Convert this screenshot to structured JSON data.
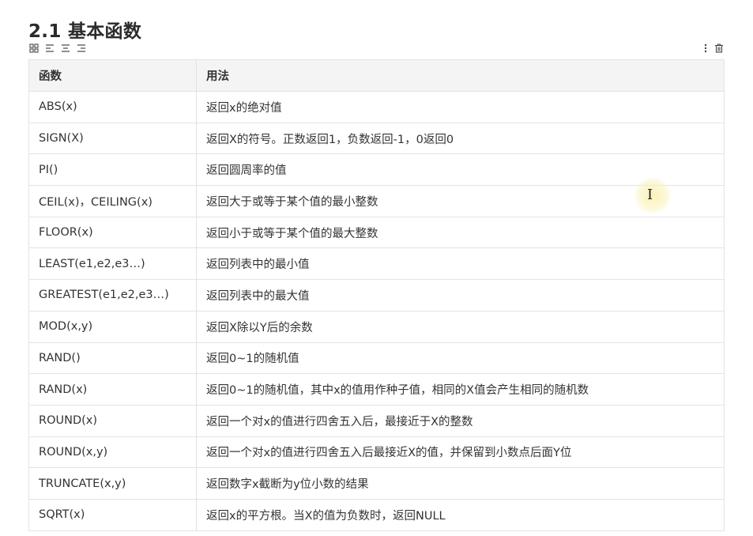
{
  "heading": "2.1 基本函数",
  "table": {
    "headers": [
      "函数",
      "用法"
    ],
    "rows": [
      [
        "ABS(x)",
        "返回x的绝对值"
      ],
      [
        "SIGN(X)",
        "返回X的符号。正数返回1，负数返回-1，0返回0"
      ],
      [
        "PI()",
        "返回圆周率的值"
      ],
      [
        "CEIL(x)，CEILING(x)",
        "返回大于或等于某个值的最小整数"
      ],
      [
        "FLOOR(x)",
        "返回小于或等于某个值的最大整数"
      ],
      [
        "LEAST(e1,e2,e3…)",
        "返回列表中的最小值"
      ],
      [
        "GREATEST(e1,e2,e3…)",
        "返回列表中的最大值"
      ],
      [
        "MOD(x,y)",
        "返回X除以Y后的余数"
      ],
      [
        "RAND()",
        "返回0~1的随机值"
      ],
      [
        "RAND(x)",
        "返回0~1的随机值，其中x的值用作种子值，相同的X值会产生相同的随机数"
      ],
      [
        "ROUND(x)",
        "返回一个对x的值进行四舍五入后，最接近于X的整数"
      ],
      [
        "ROUND(x,y)",
        "返回一个对x的值进行四舍五入后最接近X的值，并保留到小数点后面Y位"
      ],
      [
        "TRUNCATE(x,y)",
        "返回数字x截断为y位小数的结果"
      ],
      [
        "SQRT(x)",
        "返回x的平方根。当X的值为负数时，返回NULL"
      ]
    ]
  },
  "toolbar": {
    "left_icons": [
      "grid-icon",
      "align-left-icon",
      "align-center-icon",
      "align-right-icon"
    ],
    "right_icons": [
      "more-vertical-icon",
      "trash-icon"
    ]
  },
  "cursor": {
    "glyph": "I"
  }
}
